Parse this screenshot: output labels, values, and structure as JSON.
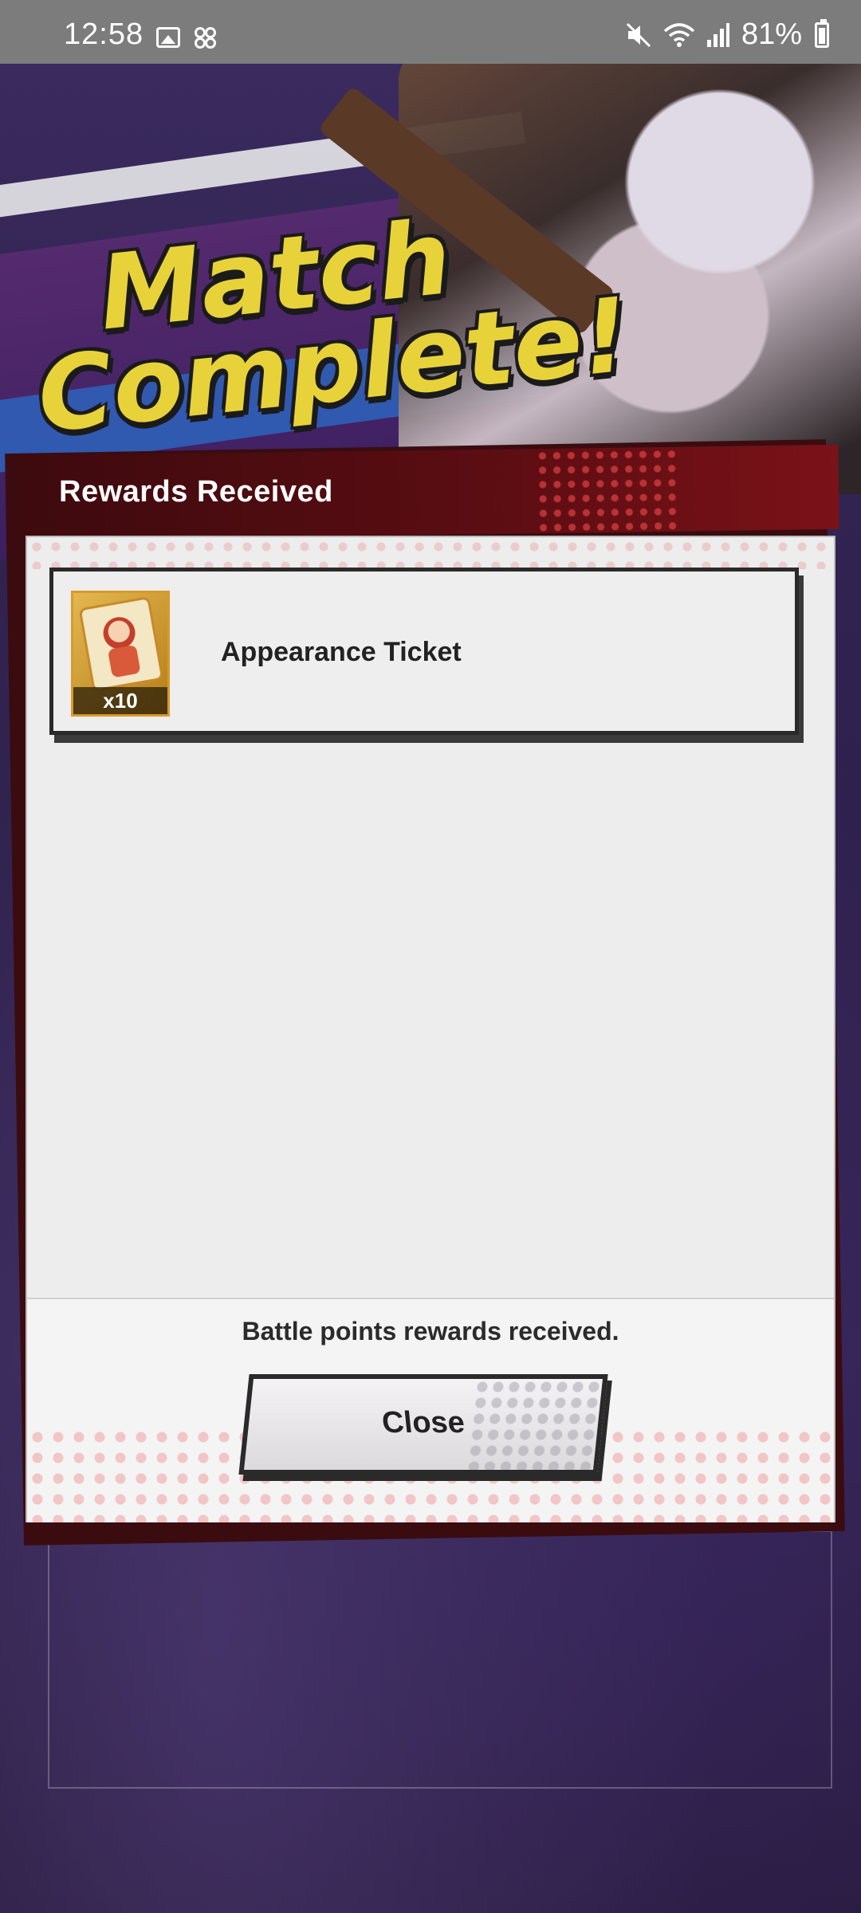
{
  "status_bar": {
    "time": "12:58",
    "battery_percent": "81%",
    "icons": [
      "gallery-icon",
      "dots-icon",
      "mute-icon",
      "wifi-icon",
      "signal-icon",
      "battery-icon"
    ]
  },
  "banner": {
    "line1": "Match",
    "line2": "Complete!"
  },
  "dialog": {
    "title": "Rewards Received",
    "rewards": [
      {
        "name": "Appearance Ticket",
        "quantity": "x10",
        "icon": "appearance-ticket-icon"
      }
    ],
    "message": "Battle points rewards received.",
    "close_label": "Close"
  },
  "colors": {
    "header": "#5a0d12",
    "title_text": "#e8d23a",
    "panel": "#ededed",
    "status_bar": "#7c7c7c"
  }
}
